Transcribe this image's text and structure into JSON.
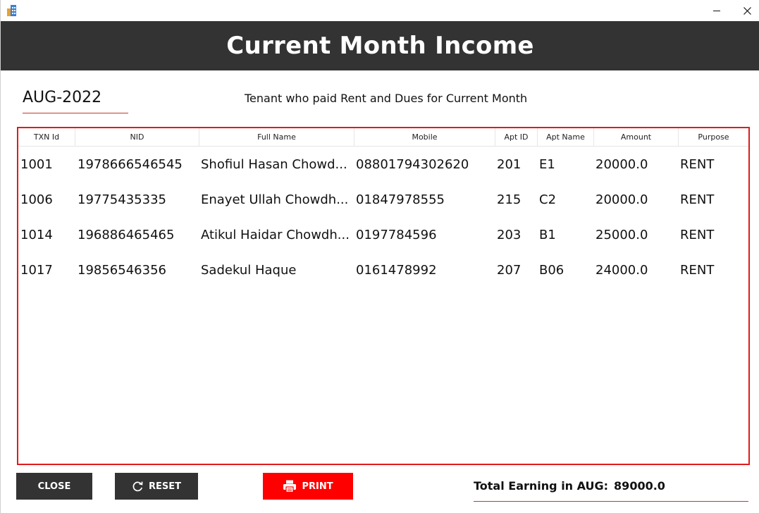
{
  "window": {
    "minimize_icon": "minimize-icon",
    "close_icon": "close-icon"
  },
  "header": {
    "title": "Current Month Income"
  },
  "month": {
    "label": "AUG-2022"
  },
  "subtitle": "Tenant who paid Rent and Dues for Current Month",
  "table": {
    "columns": [
      "TXN Id",
      "NID",
      "Full Name",
      "Mobile",
      "Apt ID",
      "Apt Name",
      "Amount",
      "Purpose"
    ],
    "rows": [
      [
        "1001",
        "1978666546545",
        "Shofiul Hasan Chowd...",
        "08801794302620",
        "201",
        "E1",
        "20000.0",
        "RENT"
      ],
      [
        "1006",
        "19775435335",
        "Enayet Ullah Chowdh...",
        "01847978555",
        "215",
        "C2",
        "20000.0",
        "RENT"
      ],
      [
        "1014",
        "196886465465",
        "Atikul Haidar Chowdh...",
        "0197784596",
        "203",
        "B1",
        "25000.0",
        "RENT"
      ],
      [
        "1017",
        "19856546356",
        "Sadekul Haque",
        "0161478992",
        "207",
        "B06",
        "24000.0",
        "RENT"
      ]
    ]
  },
  "buttons": {
    "close": "CLOSE",
    "reset": "RESET",
    "print": "PRINT"
  },
  "total": {
    "label": "Total Earning in AUG:",
    "value": "89000.0"
  },
  "colors": {
    "header_bg": "#333333",
    "accent_red": "#ff0000",
    "table_border": "#e01b1b"
  }
}
